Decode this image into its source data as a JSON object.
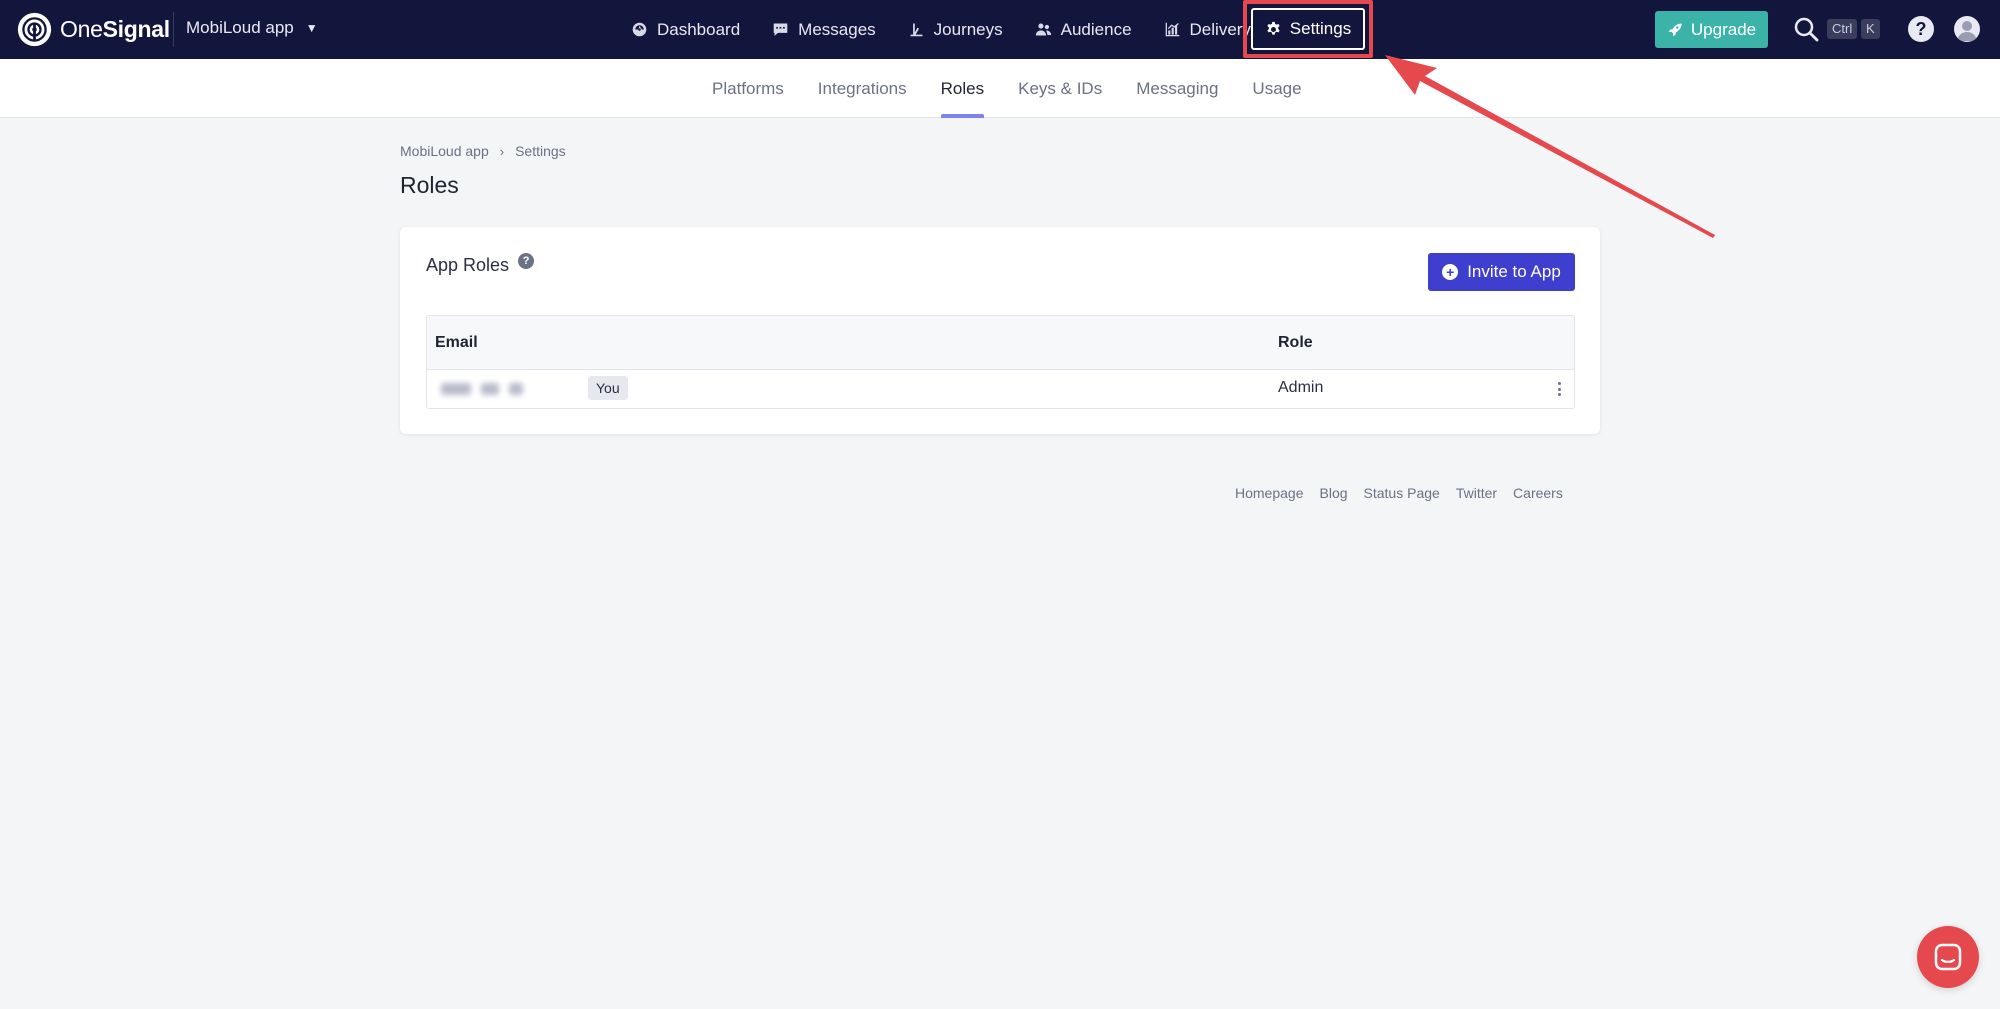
{
  "brand": {
    "name_light": "One",
    "name_bold": "Signal"
  },
  "app_switcher": {
    "label": "MobiLoud app"
  },
  "nav": [
    {
      "label": "Dashboard",
      "icon": "dashboard-icon"
    },
    {
      "label": "Messages",
      "icon": "messages-icon"
    },
    {
      "label": "Journeys",
      "icon": "journeys-icon"
    },
    {
      "label": "Audience",
      "icon": "audience-icon"
    },
    {
      "label": "Delivery",
      "icon": "delivery-icon"
    },
    {
      "label": "Settings",
      "icon": "gear-icon",
      "active": true
    }
  ],
  "header_right": {
    "upgrade_label": "Upgrade",
    "kbd_ctrl": "Ctrl",
    "kbd_k": "K",
    "help": "?"
  },
  "subnav": [
    {
      "label": "Platforms"
    },
    {
      "label": "Integrations"
    },
    {
      "label": "Roles",
      "active": true
    },
    {
      "label": "Keys & IDs"
    },
    {
      "label": "Messaging"
    },
    {
      "label": "Usage"
    }
  ],
  "breadcrumb": {
    "app": "MobiLoud app",
    "sep": "›",
    "current": "Settings"
  },
  "page_title": "Roles",
  "card": {
    "title": "App Roles",
    "help": "?",
    "invite_label": "Invite to App",
    "table": {
      "headers": {
        "email": "Email",
        "role": "Role"
      },
      "rows": [
        {
          "email": "",
          "badge": "You",
          "role": "Admin"
        }
      ]
    }
  },
  "footer": [
    "Homepage",
    "Blog",
    "Status Page",
    "Twitter",
    "Careers"
  ],
  "colors": {
    "nav_bg": "#13163c",
    "upgrade": "#3bb3a8",
    "invite": "#3f3fcf",
    "annotation": "#e5484d",
    "active_tab": "#7e83e8"
  }
}
